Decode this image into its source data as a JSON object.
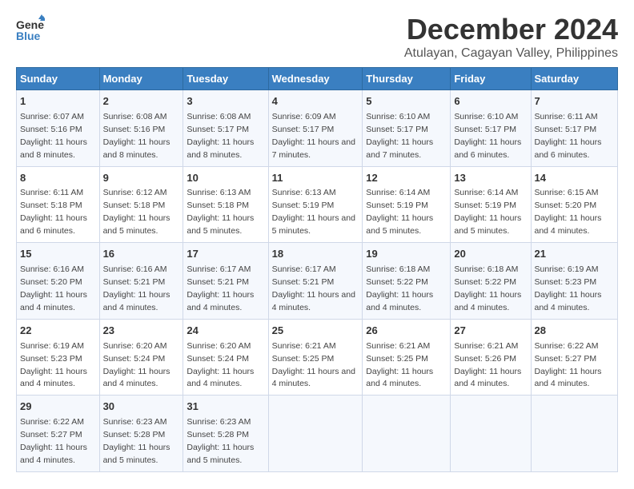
{
  "logo": {
    "general": "General",
    "blue": "Blue"
  },
  "title": "December 2024",
  "subtitle": "Atulayan, Cagayan Valley, Philippines",
  "days_header": [
    "Sunday",
    "Monday",
    "Tuesday",
    "Wednesday",
    "Thursday",
    "Friday",
    "Saturday"
  ],
  "weeks": [
    [
      {
        "day": "1",
        "sunrise": "6:07 AM",
        "sunset": "5:16 PM",
        "daylight": "11 hours and 8 minutes."
      },
      {
        "day": "2",
        "sunrise": "6:08 AM",
        "sunset": "5:16 PM",
        "daylight": "11 hours and 8 minutes."
      },
      {
        "day": "3",
        "sunrise": "6:08 AM",
        "sunset": "5:17 PM",
        "daylight": "11 hours and 8 minutes."
      },
      {
        "day": "4",
        "sunrise": "6:09 AM",
        "sunset": "5:17 PM",
        "daylight": "11 hours and 7 minutes."
      },
      {
        "day": "5",
        "sunrise": "6:10 AM",
        "sunset": "5:17 PM",
        "daylight": "11 hours and 7 minutes."
      },
      {
        "day": "6",
        "sunrise": "6:10 AM",
        "sunset": "5:17 PM",
        "daylight": "11 hours and 6 minutes."
      },
      {
        "day": "7",
        "sunrise": "6:11 AM",
        "sunset": "5:17 PM",
        "daylight": "11 hours and 6 minutes."
      }
    ],
    [
      {
        "day": "8",
        "sunrise": "6:11 AM",
        "sunset": "5:18 PM",
        "daylight": "11 hours and 6 minutes."
      },
      {
        "day": "9",
        "sunrise": "6:12 AM",
        "sunset": "5:18 PM",
        "daylight": "11 hours and 5 minutes."
      },
      {
        "day": "10",
        "sunrise": "6:13 AM",
        "sunset": "5:18 PM",
        "daylight": "11 hours and 5 minutes."
      },
      {
        "day": "11",
        "sunrise": "6:13 AM",
        "sunset": "5:19 PM",
        "daylight": "11 hours and 5 minutes."
      },
      {
        "day": "12",
        "sunrise": "6:14 AM",
        "sunset": "5:19 PM",
        "daylight": "11 hours and 5 minutes."
      },
      {
        "day": "13",
        "sunrise": "6:14 AM",
        "sunset": "5:19 PM",
        "daylight": "11 hours and 5 minutes."
      },
      {
        "day": "14",
        "sunrise": "6:15 AM",
        "sunset": "5:20 PM",
        "daylight": "11 hours and 4 minutes."
      }
    ],
    [
      {
        "day": "15",
        "sunrise": "6:16 AM",
        "sunset": "5:20 PM",
        "daylight": "11 hours and 4 minutes."
      },
      {
        "day": "16",
        "sunrise": "6:16 AM",
        "sunset": "5:21 PM",
        "daylight": "11 hours and 4 minutes."
      },
      {
        "day": "17",
        "sunrise": "6:17 AM",
        "sunset": "5:21 PM",
        "daylight": "11 hours and 4 minutes."
      },
      {
        "day": "18",
        "sunrise": "6:17 AM",
        "sunset": "5:21 PM",
        "daylight": "11 hours and 4 minutes."
      },
      {
        "day": "19",
        "sunrise": "6:18 AM",
        "sunset": "5:22 PM",
        "daylight": "11 hours and 4 minutes."
      },
      {
        "day": "20",
        "sunrise": "6:18 AM",
        "sunset": "5:22 PM",
        "daylight": "11 hours and 4 minutes."
      },
      {
        "day": "21",
        "sunrise": "6:19 AM",
        "sunset": "5:23 PM",
        "daylight": "11 hours and 4 minutes."
      }
    ],
    [
      {
        "day": "22",
        "sunrise": "6:19 AM",
        "sunset": "5:23 PM",
        "daylight": "11 hours and 4 minutes."
      },
      {
        "day": "23",
        "sunrise": "6:20 AM",
        "sunset": "5:24 PM",
        "daylight": "11 hours and 4 minutes."
      },
      {
        "day": "24",
        "sunrise": "6:20 AM",
        "sunset": "5:24 PM",
        "daylight": "11 hours and 4 minutes."
      },
      {
        "day": "25",
        "sunrise": "6:21 AM",
        "sunset": "5:25 PM",
        "daylight": "11 hours and 4 minutes."
      },
      {
        "day": "26",
        "sunrise": "6:21 AM",
        "sunset": "5:25 PM",
        "daylight": "11 hours and 4 minutes."
      },
      {
        "day": "27",
        "sunrise": "6:21 AM",
        "sunset": "5:26 PM",
        "daylight": "11 hours and 4 minutes."
      },
      {
        "day": "28",
        "sunrise": "6:22 AM",
        "sunset": "5:27 PM",
        "daylight": "11 hours and 4 minutes."
      }
    ],
    [
      {
        "day": "29",
        "sunrise": "6:22 AM",
        "sunset": "5:27 PM",
        "daylight": "11 hours and 4 minutes."
      },
      {
        "day": "30",
        "sunrise": "6:23 AM",
        "sunset": "5:28 PM",
        "daylight": "11 hours and 5 minutes."
      },
      {
        "day": "31",
        "sunrise": "6:23 AM",
        "sunset": "5:28 PM",
        "daylight": "11 hours and 5 minutes."
      },
      null,
      null,
      null,
      null
    ]
  ]
}
